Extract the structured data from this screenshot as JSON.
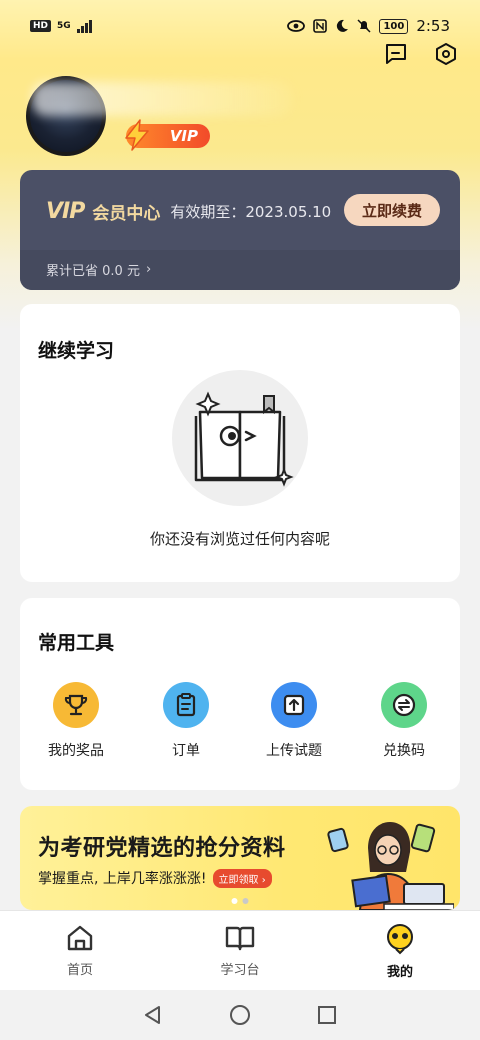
{
  "status_bar": {
    "left_badge": "HD",
    "network": "5G",
    "battery": "100",
    "time": "2:53"
  },
  "top_icons": [
    "message-icon",
    "settings-hexagon-icon"
  ],
  "profile": {
    "vip_tag": "VIP"
  },
  "vip_card": {
    "logo": "VIP",
    "title": "会员中心",
    "valid_until": "有效期至：2023.05.10",
    "renew_button": "立即续费",
    "saved": "累计已省 0.0 元",
    "saved_arrow": "›"
  },
  "continue_learning": {
    "title": "继续学习",
    "empty_text": "你还没有浏览过任何内容呢"
  },
  "tools": {
    "title": "常用工具",
    "items": [
      {
        "label": "我的奖品",
        "icon": "trophy-icon",
        "color": "#f7b935"
      },
      {
        "label": "订单",
        "icon": "clipboard-icon",
        "color": "#4fb3ef"
      },
      {
        "label": "上传试题",
        "icon": "upload-icon",
        "color": "#3d8df0"
      },
      {
        "label": "兑换码",
        "icon": "exchange-icon",
        "color": "#5ed58a"
      }
    ]
  },
  "banner": {
    "title": "为考研党精选的抢分资料",
    "subtitle": "掌握重点, 上岸几率涨涨涨!",
    "cta": "立即领取 ›"
  },
  "tabbar": {
    "items": [
      {
        "label": "首页",
        "icon": "home-icon",
        "active": false
      },
      {
        "label": "学习台",
        "icon": "book-icon",
        "active": false
      },
      {
        "label": "我的",
        "icon": "mascot-icon",
        "active": true
      }
    ]
  },
  "nav_bar": [
    "back-triangle-icon",
    "home-circle-icon",
    "recent-square-icon"
  ],
  "colors": {
    "accent_yellow": "#ffe873",
    "vip_card_bg": "#4b5066",
    "vip_gold": "#f3d9a0",
    "vip_orange": "#f24b2a"
  }
}
